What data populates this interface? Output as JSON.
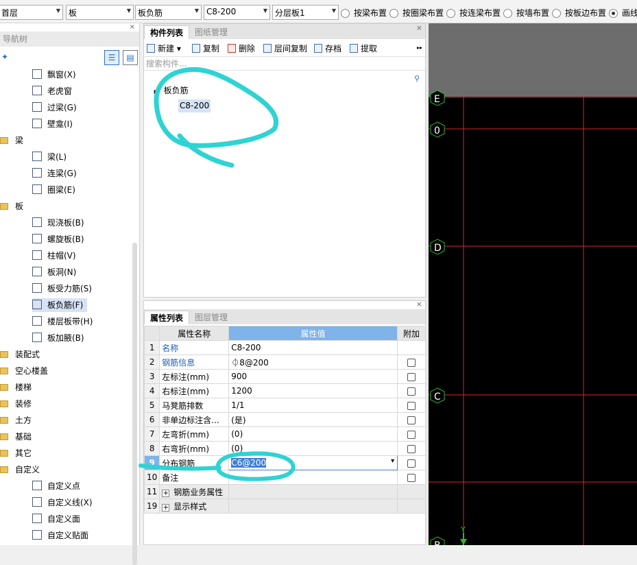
{
  "toolbar": {
    "floor": "首层",
    "category": "板",
    "type": "板负筋",
    "spec": "C8-200",
    "layer": "分层板1",
    "radios": [
      {
        "label": "按梁布置",
        "checked": false
      },
      {
        "label": "按圈梁布置",
        "checked": false
      },
      {
        "label": "按连梁布置",
        "checked": false
      },
      {
        "label": "按墙布置",
        "checked": false
      },
      {
        "label": "按板边布置",
        "checked": false
      },
      {
        "label": "画线",
        "checked": true
      }
    ]
  },
  "nav": {
    "title": "导航树",
    "close": "×",
    "items": [
      {
        "label": "飘窗(X)",
        "kind": "item"
      },
      {
        "label": "老虎窗",
        "kind": "item"
      },
      {
        "label": "过梁(G)",
        "kind": "item"
      },
      {
        "label": "壁龛(I)",
        "kind": "item"
      },
      {
        "label": "梁",
        "kind": "folder"
      },
      {
        "label": "梁(L)",
        "kind": "item"
      },
      {
        "label": "连梁(G)",
        "kind": "item"
      },
      {
        "label": "圈梁(E)",
        "kind": "item"
      },
      {
        "label": "板",
        "kind": "folder"
      },
      {
        "label": "现浇板(B)",
        "kind": "item"
      },
      {
        "label": "螺旋板(B)",
        "kind": "item"
      },
      {
        "label": "柱帽(V)",
        "kind": "item"
      },
      {
        "label": "板洞(N)",
        "kind": "item"
      },
      {
        "label": "板受力筋(S)",
        "kind": "item"
      },
      {
        "label": "板负筋(F)",
        "kind": "item",
        "selected": true
      },
      {
        "label": "楼层板带(H)",
        "kind": "item"
      },
      {
        "label": "板加腋(B)",
        "kind": "item"
      },
      {
        "label": "装配式",
        "kind": "folder"
      },
      {
        "label": "空心楼盖",
        "kind": "folder"
      },
      {
        "label": "楼梯",
        "kind": "folder"
      },
      {
        "label": "装修",
        "kind": "folder"
      },
      {
        "label": "土方",
        "kind": "folder"
      },
      {
        "label": "基础",
        "kind": "folder"
      },
      {
        "label": "其它",
        "kind": "folder"
      },
      {
        "label": "自定义",
        "kind": "folder"
      },
      {
        "label": "自定义点",
        "kind": "item"
      },
      {
        "label": "自定义线(X)",
        "kind": "item"
      },
      {
        "label": "自定义面",
        "kind": "item"
      },
      {
        "label": "自定义贴面",
        "kind": "item"
      }
    ]
  },
  "component_panel": {
    "tabs": [
      "构件列表",
      "图纸管理"
    ],
    "active_tab": 0,
    "close": "×",
    "actions": [
      "新建",
      "复制",
      "删除",
      "层间复制",
      "存档",
      "提取"
    ],
    "new_arrow": "▾",
    "more": "▸▸",
    "search_placeholder": "搜索构件...",
    "tree_root": "板负筋",
    "tree_child": "C8-200"
  },
  "property_panel": {
    "tabs": [
      "属性列表",
      "图层管理"
    ],
    "active_tab": 0,
    "close": "×",
    "headers": [
      "属性名称",
      "属性值",
      "附加"
    ],
    "rows": [
      {
        "num": "1",
        "name": "名称",
        "value": "C8-200",
        "blue": true,
        "check": false
      },
      {
        "num": "2",
        "name": "钢筋信息",
        "value": "⏀8@200",
        "blue": true,
        "check": true
      },
      {
        "num": "3",
        "name": "左标注(mm)",
        "value": "900",
        "blue": false,
        "check": true
      },
      {
        "num": "4",
        "name": "右标注(mm)",
        "value": "1200",
        "blue": false,
        "check": true
      },
      {
        "num": "5",
        "name": "马凳筋排数",
        "value": "1/1",
        "blue": false,
        "check": true
      },
      {
        "num": "6",
        "name": "非单边标注含...",
        "value": "(是)",
        "blue": false,
        "check": true
      },
      {
        "num": "7",
        "name": "左弯折(mm)",
        "value": "(0)",
        "blue": false,
        "check": true
      },
      {
        "num": "8",
        "name": "右弯折(mm)",
        "value": "(0)",
        "blue": false,
        "check": true
      },
      {
        "num": "9",
        "name": "分布钢筋",
        "value": "C6@200",
        "blue": false,
        "check": true,
        "editing": true
      },
      {
        "num": "10",
        "name": "备注",
        "value": "",
        "blue": false,
        "check": true
      },
      {
        "num": "11",
        "name": "钢筋业务属性",
        "value": "",
        "blue": false,
        "check": false,
        "expand": true
      },
      {
        "num": "19",
        "name": "显示样式",
        "value": "",
        "blue": false,
        "check": false,
        "expand": true
      }
    ]
  },
  "canvas": {
    "axis_labels": [
      "E",
      "0",
      "D",
      "C",
      "B"
    ],
    "ucs_label": "Y",
    "colors": {
      "grid": "#e8202a",
      "marker": "#2eb82e",
      "annotation": "#2ed3d3"
    }
  }
}
